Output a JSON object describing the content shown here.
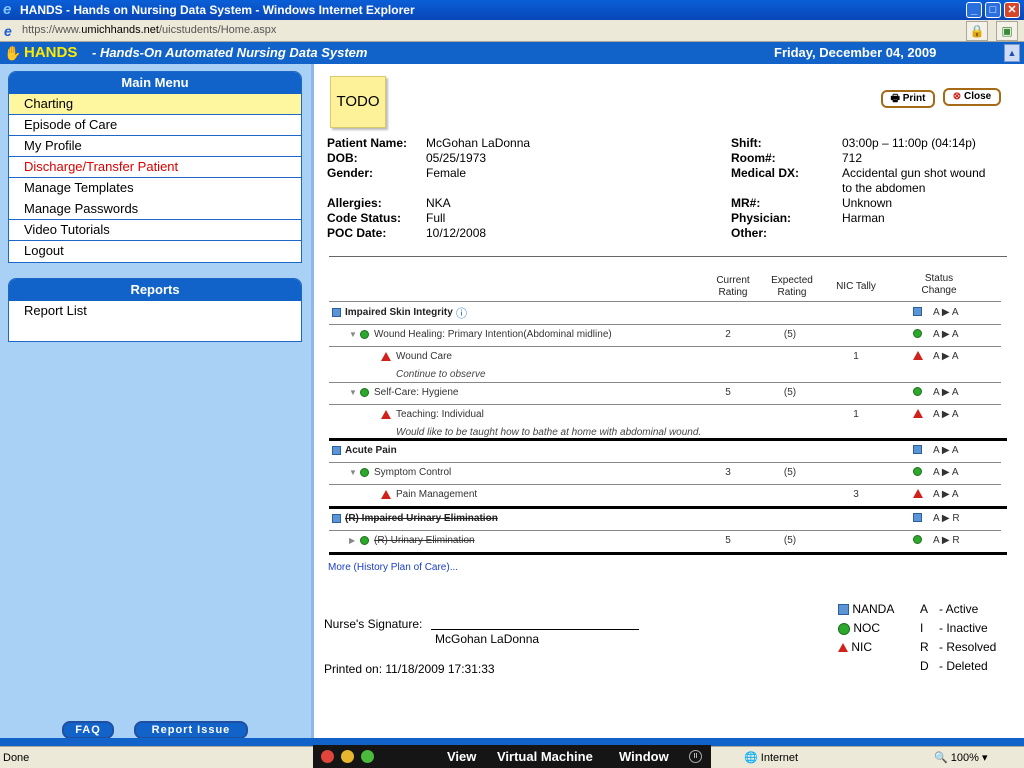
{
  "window": {
    "title": "HANDS - Hands on Nursing Data System - Windows Internet Explorer"
  },
  "address": {
    "url_prefix": "https://www.",
    "url_domain": "umichhands.net",
    "url_path": "/uicstudents/Home.aspx"
  },
  "header": {
    "brand": "HANDS",
    "subtitle": "- Hands-On Automated Nursing Data System",
    "date": "Friday, December 04, 2009"
  },
  "main_menu": {
    "title": "Main Menu",
    "items": [
      "Charting",
      "Episode of Care",
      "My Profile",
      "Discharge/Transfer Patient",
      "Manage Templates",
      "Manage Passwords",
      "Video Tutorials",
      "Logout"
    ]
  },
  "reports": {
    "title": "Reports",
    "items": [
      "Report List"
    ]
  },
  "bottom": {
    "faq": "FAQ",
    "report_issue": "Report Issue"
  },
  "todo": "TODO",
  "toolbar": {
    "print": "Print",
    "close": "Close"
  },
  "patient": {
    "name_label": "Patient Name:",
    "name": "McGohan LaDonna",
    "dob_label": "DOB:",
    "dob": "05/25/1973",
    "gender_label": "Gender:",
    "gender": "Female",
    "allergies_label": "Allergies:",
    "allergies": "NKA",
    "code_label": "Code Status:",
    "code": "Full",
    "poc_label": "POC Date:",
    "poc": "10/12/2008",
    "shift_label": "Shift:",
    "shift": "03:00p – 11:00p (04:14p)",
    "room_label": "Room#:",
    "room": "712",
    "dx_label": "Medical DX:",
    "dx_line1": "Accidental gun shot wound",
    "dx_line2": "to the abdomen",
    "mr_label": "MR#:",
    "mr": "Unknown",
    "physician_label": "Physician:",
    "physician": "Harman",
    "other_label": "Other:"
  },
  "table_headers": {
    "current_line1": "Current",
    "current_line2": "Rating",
    "expected_line1": "Expected",
    "expected_line2": "Rating",
    "nic": "NIC Tally",
    "status_line1": "Status",
    "status_line2": "Change"
  },
  "rows": [
    {
      "label": "Impaired Skin Integrity",
      "status": "A ▶ A"
    },
    {
      "label": "Wound Healing: Primary Intention(Abdominal midline)",
      "current": "2",
      "expected": "(5)",
      "status": "A ▶ A"
    },
    {
      "label": "Wound Care",
      "tally": "1",
      "status": "A ▶ A",
      "note": "Continue to observe"
    },
    {
      "label": "Self-Care: Hygiene",
      "current": "5",
      "expected": "(5)",
      "status": "A ▶ A"
    },
    {
      "label": "Teaching: Individual",
      "tally": "1",
      "status": "A ▶ A",
      "note": "Would like to be taught how to bathe at home with abdominal wound."
    },
    {
      "label": "Acute Pain",
      "status": "A ▶ A"
    },
    {
      "label": "Symptom Control",
      "current": "3",
      "expected": "(5)",
      "status": "A ▶ A"
    },
    {
      "label": "Pain Management",
      "tally": "3",
      "status": "A ▶ A"
    },
    {
      "label": "(R) Impaired Urinary Elimination",
      "status": "A ▶ R"
    },
    {
      "label": "(R) Urinary Elimination",
      "current": "5",
      "expected": "(5)",
      "status": "A ▶ R"
    }
  ],
  "more_link": "More (History Plan of Care)...",
  "signature": {
    "label": "Nurse's Signature:",
    "name": "McGohan LaDonna",
    "printed": "Printed on: 11/18/2009 17:31:33"
  },
  "legend": {
    "nanda": "NANDA",
    "noc": "NOC",
    "nic": "NIC",
    "a": "A",
    "a_desc": "- Active",
    "i": "I",
    "i_desc": "- Inactive",
    "r": "R",
    "r_desc": "- Resolved",
    "d": "D",
    "d_desc": "- Deleted"
  },
  "statusbar": {
    "done": "Done",
    "zone": "Internet",
    "zoom": "100%"
  },
  "vm_menu": {
    "view": "View",
    "vm": "Virtual Machine",
    "window": "Window"
  },
  "colors": {
    "brand_blue": "#1263c9",
    "selected_menu": "#fff6a0",
    "discharge_red": "#d90000"
  }
}
